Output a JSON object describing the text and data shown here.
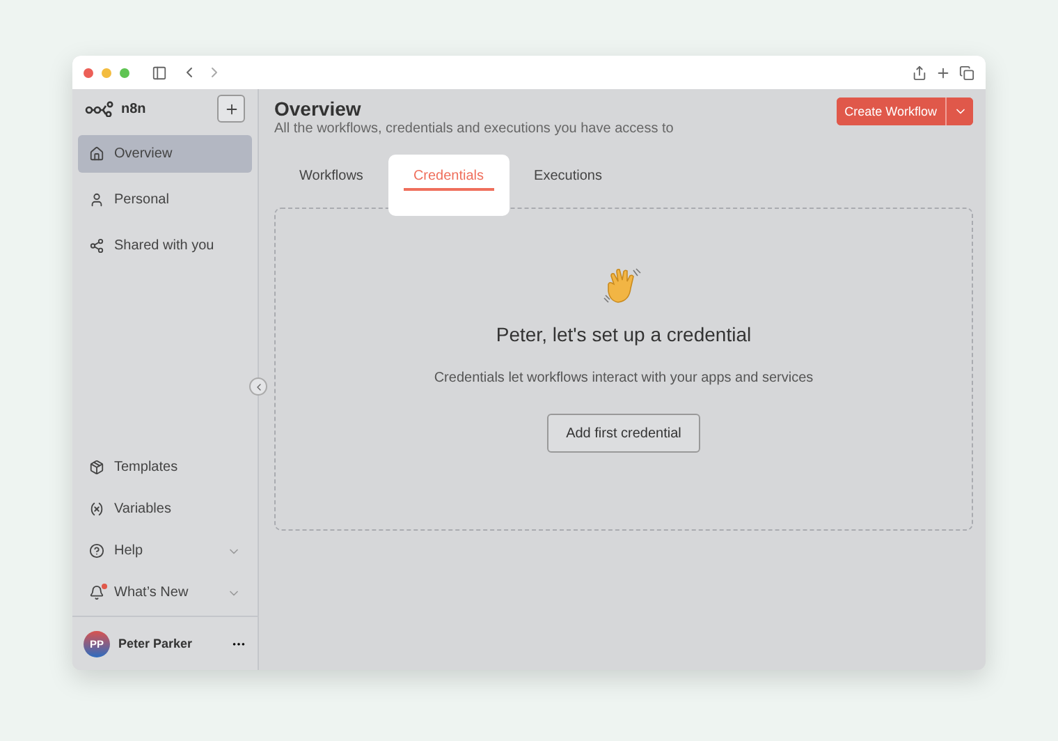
{
  "sidebar": {
    "logo": "n8n",
    "top_items": [
      {
        "label": "Overview",
        "selected": true
      },
      {
        "label": "Personal",
        "selected": false
      },
      {
        "label": "Shared with you",
        "selected": false
      }
    ],
    "bottom_items": [
      {
        "label": "Templates",
        "has_submenu": false,
        "badge": false
      },
      {
        "label": "Variables",
        "has_submenu": false,
        "badge": false
      },
      {
        "label": "Help",
        "has_submenu": true,
        "badge": false
      },
      {
        "label": "What’s New",
        "has_submenu": true,
        "badge": true
      }
    ],
    "user": {
      "initials": "PP",
      "name": "Peter Parker"
    }
  },
  "header": {
    "title": "Overview",
    "subtitle": "All the workflows, credentials and executions you have access to",
    "create_button": "Create Workflow"
  },
  "tabs": [
    {
      "label": "Workflows",
      "selected": false
    },
    {
      "label": "Credentials",
      "selected": true
    },
    {
      "label": "Executions",
      "selected": false
    }
  ],
  "empty_state": {
    "heading": "Peter, let's set up a credential",
    "description": "Credentials let workflows interact with your apps and services",
    "button": "Add first credential"
  }
}
